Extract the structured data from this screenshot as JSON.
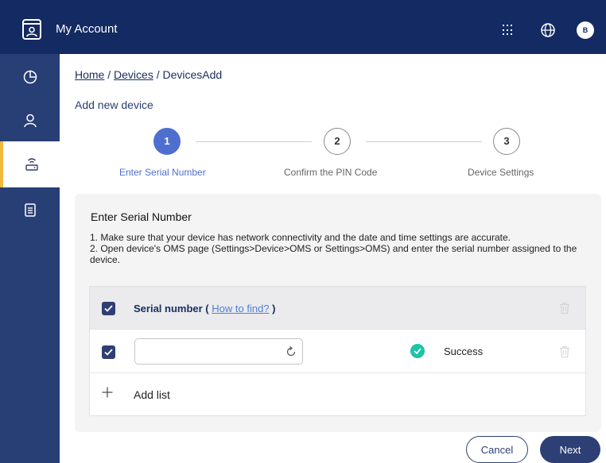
{
  "header": {
    "title": "My Account",
    "avatar_initial": "B",
    "icons": [
      "app-logo-icon",
      "apps-grid-icon",
      "globe-icon"
    ]
  },
  "sidebar": {
    "items": [
      {
        "icon": "dashboard-pie-icon",
        "active": false
      },
      {
        "icon": "user-icon",
        "active": false
      },
      {
        "icon": "router-device-icon",
        "active": true
      },
      {
        "icon": "document-list-icon",
        "active": false
      }
    ],
    "active_accent": "#f0b93c"
  },
  "breadcrumb": {
    "home": "Home",
    "sep1": " / ",
    "devices": "Devices",
    "sep2": " / ",
    "current": "DevicesAdd"
  },
  "page_title": "Add new device",
  "stepper": {
    "steps": [
      {
        "number": "1",
        "label": "Enter Serial Number",
        "active": true
      },
      {
        "number": "2",
        "label": "Confirm the PIN Code",
        "active": false
      },
      {
        "number": "3",
        "label": "Device Settings",
        "active": false
      }
    ]
  },
  "section": {
    "title": "Enter Serial Number",
    "instructions": [
      "1. Make sure that your device has network connectivity and the date and time settings are accurate.",
      "2. Open device's OMS page (Settings>Device>OMS or Settings>OMS) and enter the serial number assigned to the device."
    ]
  },
  "table": {
    "header_label": "Serial number (",
    "header_link": "How to find?",
    "header_close": " )",
    "rows": [
      {
        "checked": true,
        "serial_value": "",
        "status": "Success"
      }
    ],
    "add_label": "Add list"
  },
  "buttons": {
    "cancel": "Cancel",
    "next": "Next"
  },
  "colors": {
    "topbar": "#132a62",
    "sidebar": "#283f76",
    "primary": "#2e3f75",
    "step_active": "#4e6fd0",
    "success": "#1cc5a5"
  }
}
